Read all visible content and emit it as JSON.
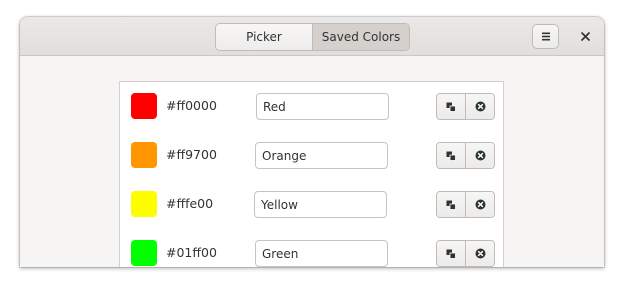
{
  "header": {
    "tabs": [
      {
        "label": "Picker",
        "active": false
      },
      {
        "label": "Saved Colors",
        "active": true
      }
    ],
    "menu_icon": "hamburger-menu-icon",
    "close_icon": "close-icon"
  },
  "saved_colors": [
    {
      "hex": "#ff0000",
      "swatch": "#ff0000",
      "name": "Red"
    },
    {
      "hex": "#ff9700",
      "swatch": "#ff9700",
      "name": "Orange"
    },
    {
      "hex": "#fffe00",
      "swatch": "#fffe00",
      "name": "Yellow"
    },
    {
      "hex": "#01ff00",
      "swatch": "#01ff00",
      "name": "Green"
    }
  ],
  "row_actions": {
    "copy_icon": "copy-icon",
    "remove_icon": "remove-icon"
  }
}
